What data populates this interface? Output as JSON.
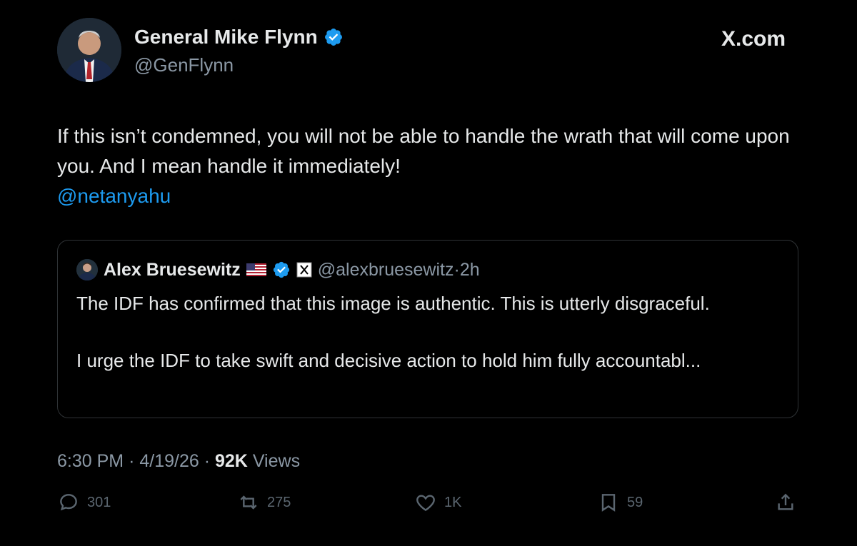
{
  "author": {
    "name": "General Mike Flynn",
    "handle": "@GenFlynn"
  },
  "brand": "X.com",
  "tweet": {
    "text": "If this isn’t condemned, you will not be able to handle the wrath that will come upon you. And I mean handle it immediately!",
    "mention": "@netanyahu"
  },
  "quote": {
    "name": "Alex Bruesewitz",
    "handle": "@alexbruesewitz",
    "separator": "·",
    "time": "2h",
    "text": "The IDF has confirmed that this image is authentic. This is utterly disgraceful.\n\nI urge the IDF to take swift and decisive action to hold him fully accountabl..."
  },
  "meta": {
    "time": "6:30 PM",
    "date": "4/19/26",
    "separator": "·",
    "views_count": "92K",
    "views_label": "Views"
  },
  "actions": {
    "replies": "301",
    "reposts": "275",
    "likes": "1K",
    "bookmarks": "59"
  },
  "colors": {
    "background": "#000000",
    "text": "#e7e9ea",
    "secondary": "#8b98a5",
    "link": "#1d9bf0",
    "verified": "#1d9bf0",
    "border": "#2f3336"
  },
  "icons": [
    "verified-badge-icon",
    "us-flag-icon",
    "x-logo-icon",
    "reply-icon",
    "repost-icon",
    "like-icon",
    "bookmark-icon",
    "share-icon"
  ]
}
